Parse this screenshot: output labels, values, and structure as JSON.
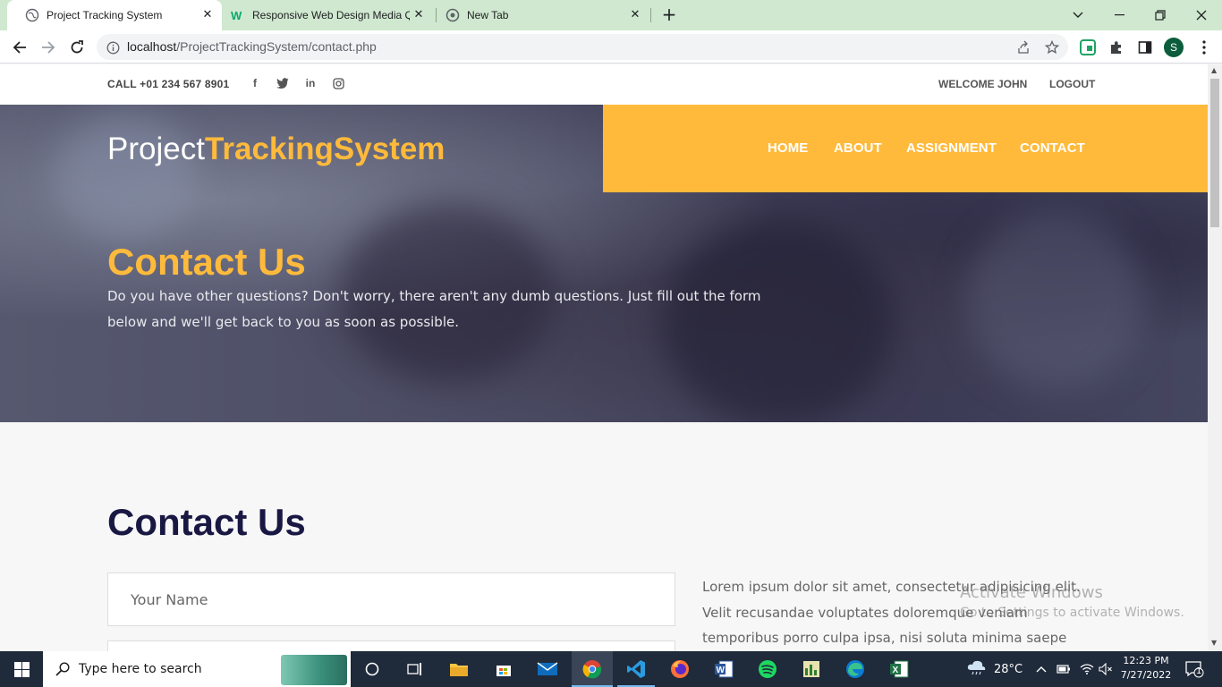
{
  "browser": {
    "tabs": [
      {
        "title": "Project Tracking System",
        "active": true
      },
      {
        "title": "Responsive Web Design Media Q",
        "active": false
      },
      {
        "title": "New Tab",
        "active": false
      }
    ],
    "url_host": "localhost",
    "url_path": "/ProjectTrackingSystem/contact.php",
    "profile_initial": "S"
  },
  "site": {
    "call": "CALL +01 234 567 8901",
    "social": [
      "facebook-icon",
      "twitter-icon",
      "linkedin-icon",
      "instagram-icon"
    ],
    "welcome": "WELCOME JOHN",
    "logout": "LOGOUT",
    "logo_plain": "Project",
    "logo_accent": "TrackingSystem",
    "nav": [
      "HOME",
      "ABOUT",
      "ASSIGNMENT",
      "CONTACT"
    ],
    "hero_title": "Contact Us",
    "hero_text": "Do you have other questions? Don't worry, there aren't any dumb questions. Just fill out the form below and we'll get back to you as soon as possible.",
    "section_title": "Contact Us",
    "name_placeholder": "Your Name",
    "lorem": "Lorem ipsum dolor sit amet, consectetur adipisicing elit. Velit recusandae voluptates doloremque veniam temporibus porro culpa ipsa, nisi soluta minima saepe",
    "accent_color": "#ffba3b",
    "heading_color": "#191843"
  },
  "watermark": {
    "title": "Activate Windows",
    "subtitle": "Go to Settings to activate Windows."
  },
  "taskbar": {
    "search_placeholder": "Type here to search",
    "temperature": "28°C",
    "time": "12:23 PM",
    "date": "7/27/2022",
    "notification_count": "1"
  }
}
